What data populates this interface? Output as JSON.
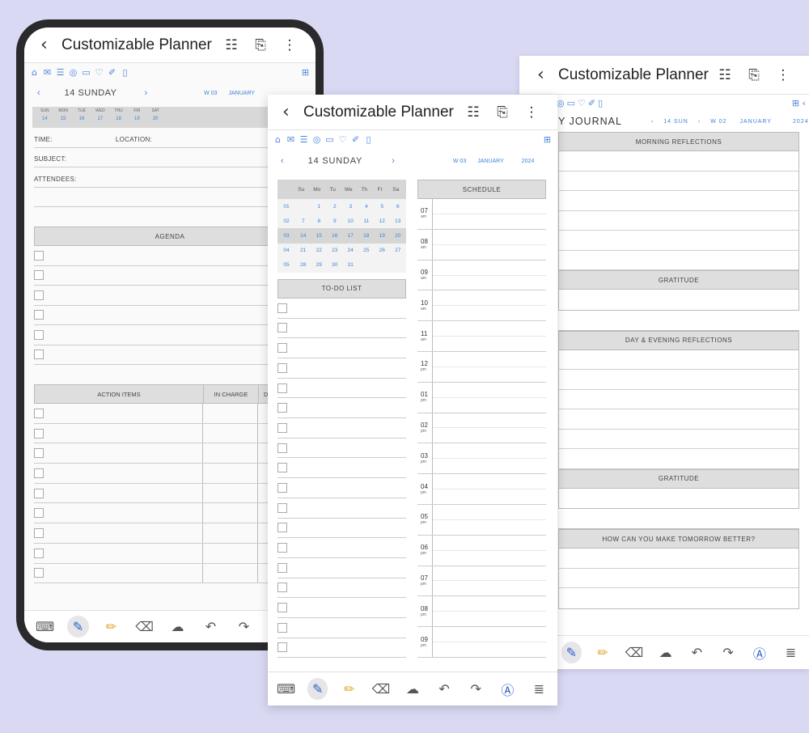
{
  "phone": {
    "title": "Customizable Planner",
    "date": "14 SUNDAY",
    "week": "W 03",
    "month": "JANUARY",
    "weekdays": [
      "SUN",
      "MON",
      "TUE",
      "WED",
      "THU",
      "FRI",
      "SAT"
    ],
    "weekdates": [
      "14",
      "15",
      "16",
      "17",
      "18",
      "19",
      "20"
    ],
    "fields": {
      "time": "TIME:",
      "location": "LOCATION:",
      "subject": "SUBJECT:",
      "attendees": "ATTENDEES:"
    },
    "agenda_title": "AGENDA",
    "action_items": "ACTION ITEMS",
    "in_charge": "IN CHARGE",
    "col3": "D"
  },
  "right": {
    "title": "Customizable Planner",
    "journal": "Y JOURNAL",
    "nav": {
      "date": "14 SUN",
      "week": "W 02",
      "month": "JANUARY",
      "year": "2024"
    },
    "sections": {
      "morning": "MORNING REFLECTIONS",
      "gratitude1": "GRATITUDE",
      "evening": "DAY & EVENING REFLECTIONS",
      "gratitude2": "GRATITUDE",
      "tomorrow": "HOW CAN YOU MAKE TOMORROW BETTER?"
    }
  },
  "mid": {
    "title": "Customizable Planner",
    "date": "14 SUNDAY",
    "week": "W 03",
    "month": "JANUARY",
    "year": "2024",
    "cal_days": [
      "Su",
      "Mo",
      "Tu",
      "We",
      "Th",
      "Fr",
      "Sa"
    ],
    "cal_rows": [
      {
        "wk": "01",
        "d": [
          "",
          "1",
          "2",
          "3",
          "4",
          "5",
          "6"
        ]
      },
      {
        "wk": "02",
        "d": [
          "7",
          "8",
          "9",
          "10",
          "11",
          "12",
          "13"
        ]
      },
      {
        "wk": "03",
        "d": [
          "14",
          "15",
          "16",
          "17",
          "18",
          "19",
          "20"
        ]
      },
      {
        "wk": "04",
        "d": [
          "21",
          "22",
          "23",
          "24",
          "25",
          "26",
          "27"
        ]
      },
      {
        "wk": "05",
        "d": [
          "28",
          "29",
          "30",
          "31",
          "",
          "",
          ""
        ]
      }
    ],
    "todo_title": "TO-DO LIST",
    "schedule_title": "SCHEDULE",
    "hours": [
      {
        "n": "07",
        "p": "am"
      },
      {
        "n": "08",
        "p": "am"
      },
      {
        "n": "09",
        "p": "am"
      },
      {
        "n": "10",
        "p": "am"
      },
      {
        "n": "11",
        "p": "am"
      },
      {
        "n": "12",
        "p": "pm"
      },
      {
        "n": "01",
        "p": "pm"
      },
      {
        "n": "02",
        "p": "pm"
      },
      {
        "n": "03",
        "p": "pm"
      },
      {
        "n": "04",
        "p": "pm"
      },
      {
        "n": "05",
        "p": "pm"
      },
      {
        "n": "06",
        "p": "pm"
      },
      {
        "n": "07",
        "p": "pm"
      },
      {
        "n": "08",
        "p": "pm"
      },
      {
        "n": "09",
        "p": "pm"
      }
    ]
  },
  "icons": {
    "back": "‹",
    "book": "📖",
    "clip": "📎",
    "more": "⋮"
  },
  "colors": {
    "accent": "#3f82d6",
    "background": "#d9d9f4",
    "header": "#dedede"
  }
}
